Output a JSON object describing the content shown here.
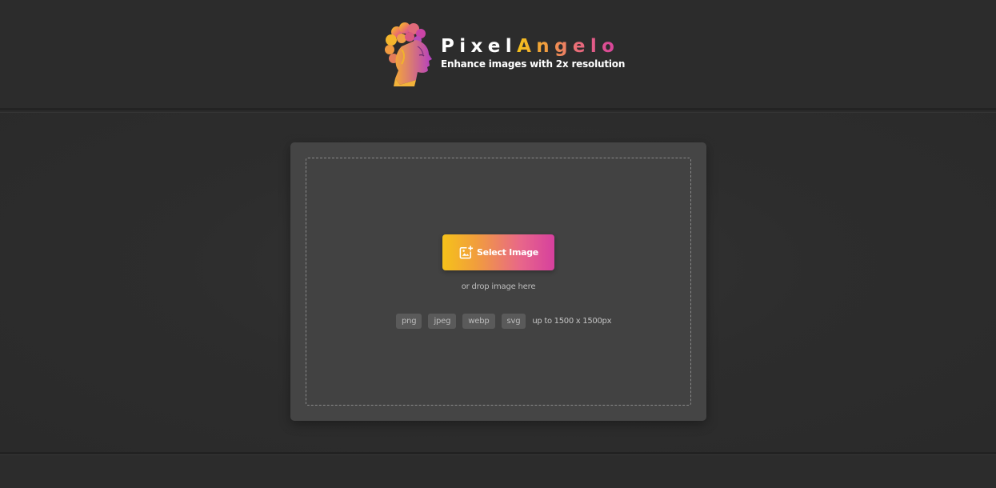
{
  "brand": {
    "name_part1": "Pixel",
    "name_part2": "Angelo",
    "tagline": "Enhance images with 2x resolution",
    "logo_icon": "statue-head-icon"
  },
  "uploader": {
    "select_button_label": "Select Image",
    "select_button_icon": "add-image-icon",
    "drop_hint": "or drop image here",
    "formats": [
      "png",
      "jpeg",
      "webp",
      "svg"
    ],
    "size_limit": "up to 1500 x 1500px"
  },
  "colors": {
    "background": "#2b2b2b",
    "card": "#454545",
    "gradient_start": "#f6c21a",
    "gradient_end": "#d6409e"
  }
}
